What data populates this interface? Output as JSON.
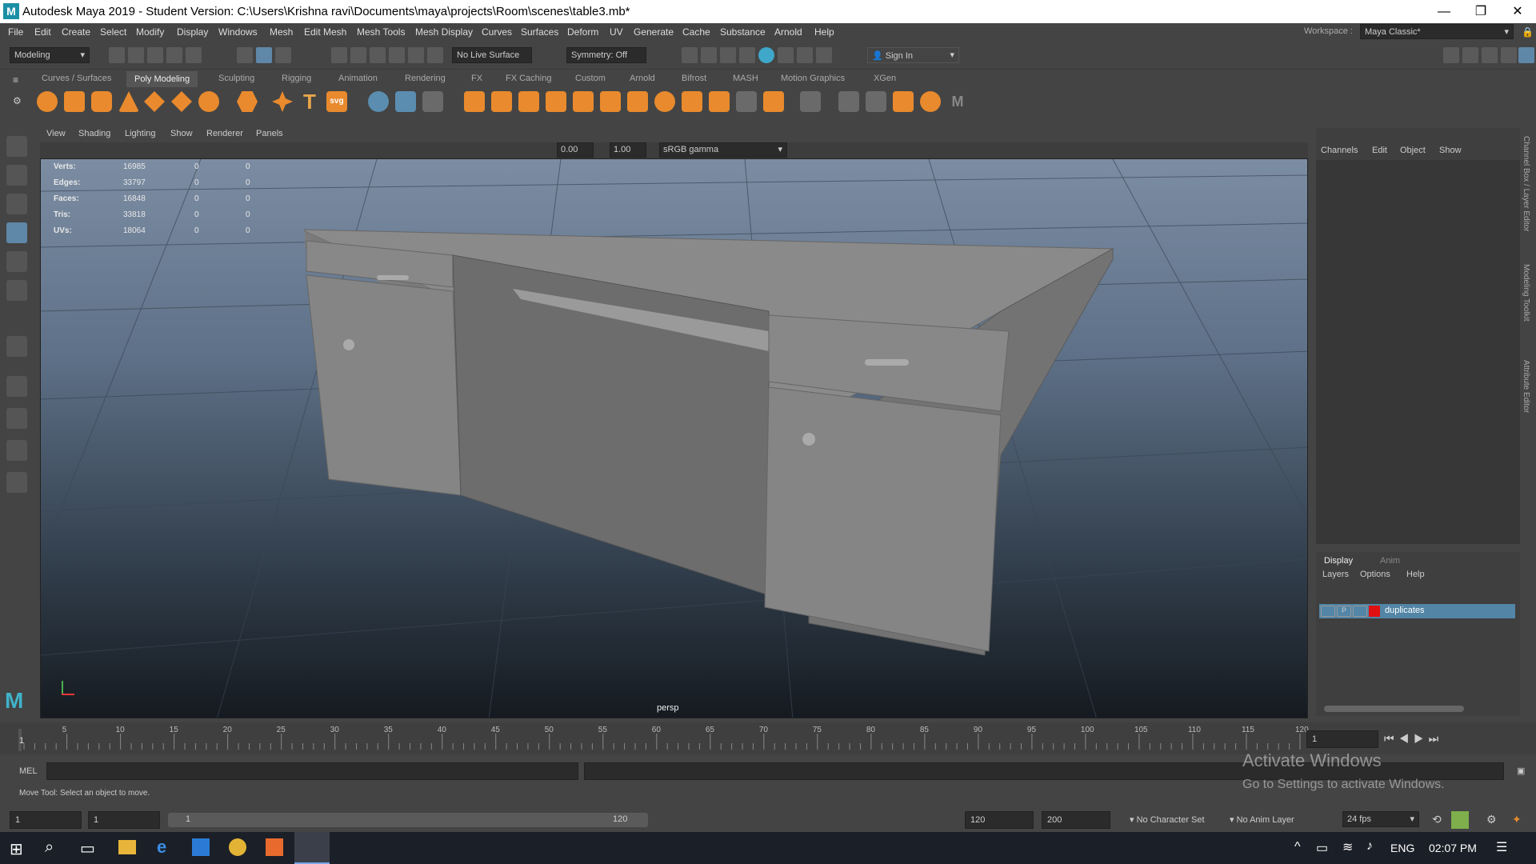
{
  "window": {
    "title": "Autodesk Maya 2019 - Student Version: C:\\Users\\Krishna ravi\\Documents\\maya\\projects\\Room\\scenes\\table3.mb*",
    "logo": "M"
  },
  "menus": [
    "File",
    "Edit",
    "Create",
    "Select",
    "Modify",
    "Display",
    "Windows",
    "Mesh",
    "Edit Mesh",
    "Mesh Tools",
    "Mesh Display",
    "Curves",
    "Surfaces",
    "Deform",
    "UV",
    "Generate",
    "Cache",
    "Substance",
    "Arnold",
    "Help"
  ],
  "toolbar": {
    "mode": "Modeling",
    "live_surface": "No Live Surface",
    "symmetry": "Symmetry: Off",
    "sign_in": "Sign In",
    "workspace_label": "Workspace :",
    "workspace": "Maya Classic*"
  },
  "shelf_tabs": [
    "Curves / Surfaces",
    "Poly Modeling",
    "Sculpting",
    "Rigging",
    "Animation",
    "Rendering",
    "FX",
    "FX Caching",
    "Custom",
    "Arnold",
    "Bifrost",
    "MASH",
    "Motion Graphics",
    "XGen"
  ],
  "shelf_active": "Poly Modeling",
  "viewport_menu": [
    "View",
    "Shading",
    "Lighting",
    "Show",
    "Renderer",
    "Panels"
  ],
  "viewport_toolbar": {
    "exposure": "0.00",
    "gamma": "1.00",
    "colorspace": "sRGB gamma"
  },
  "hud": [
    {
      "label": "Verts:",
      "v1": "16985",
      "v2": "0",
      "v3": "0"
    },
    {
      "label": "Edges:",
      "v1": "33797",
      "v2": "0",
      "v3": "0"
    },
    {
      "label": "Faces:",
      "v1": "16848",
      "v2": "0",
      "v3": "0"
    },
    {
      "label": "Tris:",
      "v1": "33818",
      "v2": "0",
      "v3": "0"
    },
    {
      "label": "UVs:",
      "v1": "18064",
      "v2": "0",
      "v3": "0"
    }
  ],
  "camera": "persp",
  "channel_box": {
    "tabs": [
      "Channels",
      "Edit",
      "Object",
      "Show"
    ]
  },
  "layer_editor": {
    "tabs": [
      "Display",
      "Anim"
    ],
    "menu": [
      "Layers",
      "Options",
      "Help"
    ],
    "layer_name": "duplicates",
    "layer_p": "P",
    "layer_color": "#e01010"
  },
  "side_tabs": [
    "Channel Box / Layer Editor",
    "Modeling Toolkit",
    "Attribute Editor"
  ],
  "timeline": {
    "ticks": [
      "5",
      "10",
      "15",
      "20",
      "25",
      "30",
      "35",
      "40",
      "45",
      "50",
      "55",
      "60",
      "65",
      "70",
      "75",
      "80",
      "85",
      "90",
      "95",
      "100",
      "105",
      "110",
      "115",
      "120"
    ],
    "start_label": "1",
    "current_frame": "1"
  },
  "mel": {
    "label": "MEL"
  },
  "help_line": "Move Tool: Select an object to move.",
  "range": {
    "start": "1",
    "inner_start": "1",
    "slider_start": "1",
    "slider_end": "120",
    "end": "120",
    "max": "200",
    "char_set": "No Character Set",
    "anim_layer": "No Anim Layer",
    "fps": "24 fps"
  },
  "watermark": {
    "line1": "Activate Windows",
    "line2": "Go to Settings to activate Windows."
  },
  "taskbar": {
    "lang": "ENG",
    "time": "02:07 PM"
  }
}
